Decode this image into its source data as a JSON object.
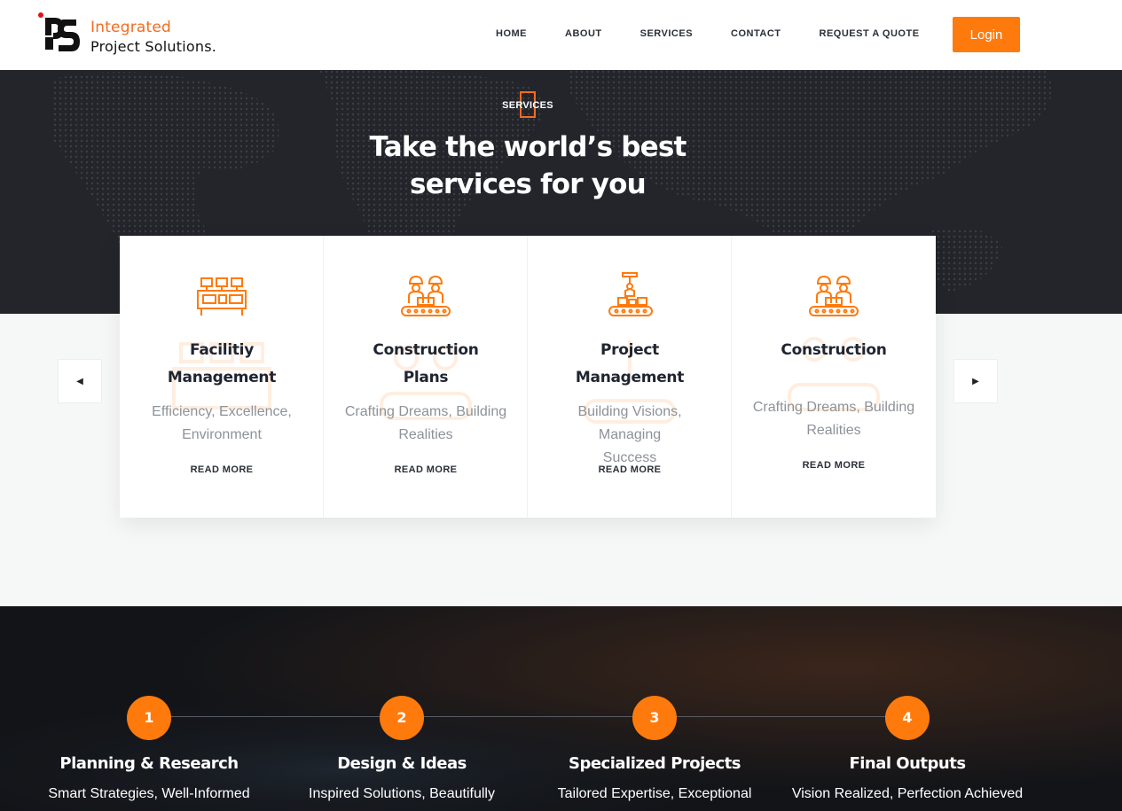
{
  "brand": {
    "name_line1": "Integrated",
    "name_line2": "Project Solutions."
  },
  "nav": {
    "items": [
      "HOME",
      "ABOUT",
      "SERVICES",
      "CONTACT",
      "REQUEST A QUOTE"
    ],
    "login_label": "Login"
  },
  "hero": {
    "eyebrow": "SERVICES",
    "title_line1": "Take the world’s best",
    "title_line2": "services for you"
  },
  "services": [
    {
      "title_line1": "Facilitiy",
      "title_line2": "Management",
      "desc_line1": "Efficiency, Excellence,",
      "desc_line2": "Environment",
      "more": "READ MORE",
      "icon": "control-panel-icon"
    },
    {
      "title_line1": "Construction",
      "title_line2": "Plans",
      "desc_line1": "Crafting Dreams, Building",
      "desc_line2": "Realities",
      "more": "READ MORE",
      "icon": "workers-icon"
    },
    {
      "title_line1": "Project",
      "title_line2": "Management",
      "desc_line1": "Building Visions, Managing",
      "desc_line2": "Success",
      "more": "READ MORE",
      "icon": "conveyor-robot-icon"
    },
    {
      "title_line1": "Construction",
      "title_line2": "",
      "desc_line1": "Crafting Dreams, Building",
      "desc_line2": "Realities",
      "more": "READ MORE",
      "icon": "workers-icon"
    }
  ],
  "steps": [
    {
      "num": "1",
      "title": "Planning & Research",
      "desc": "Smart Strategies, Well-Informed"
    },
    {
      "num": "2",
      "title": "Design & Ideas",
      "desc": "Inspired Solutions, Beautifully"
    },
    {
      "num": "3",
      "title": "Specialized Projects",
      "desc": "Tailored Expertise, Exceptional"
    },
    {
      "num": "4",
      "title": "Final Outputs",
      "desc": "Vision Realized, Perfection Achieved"
    }
  ],
  "colors": {
    "accent": "#ff7a0c",
    "dark": "#23252b",
    "text": "#1f2430"
  }
}
